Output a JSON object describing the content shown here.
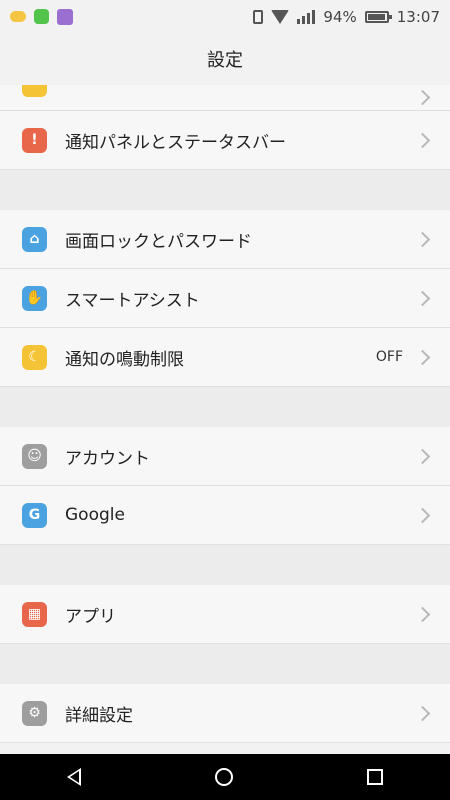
{
  "status": {
    "battery": "94%",
    "time": "13:07"
  },
  "header": {
    "title": "設定"
  },
  "rows": [
    {
      "label": "通知パネルとステータスバー",
      "icon": "bell-icon",
      "color": "#e8664a"
    },
    {
      "label": "画面ロックとパスワード",
      "icon": "lock-icon",
      "color": "#4aa3e0"
    },
    {
      "label": "スマートアシスト",
      "icon": "hand-icon",
      "color": "#4aa3e0"
    },
    {
      "label": "通知の鳴動制限",
      "icon": "moon-icon",
      "color": "#f5c336",
      "value": "OFF"
    },
    {
      "label": "アカウント",
      "icon": "user-icon",
      "color": "#9e9e9e"
    },
    {
      "label": "Google",
      "icon": "google-icon",
      "color": "#4aa3e0"
    },
    {
      "label": "アプリ",
      "icon": "apps-icon",
      "color": "#e8664a"
    },
    {
      "label": "詳細設定",
      "icon": "gear-icon",
      "color": "#9e9e9e"
    }
  ]
}
